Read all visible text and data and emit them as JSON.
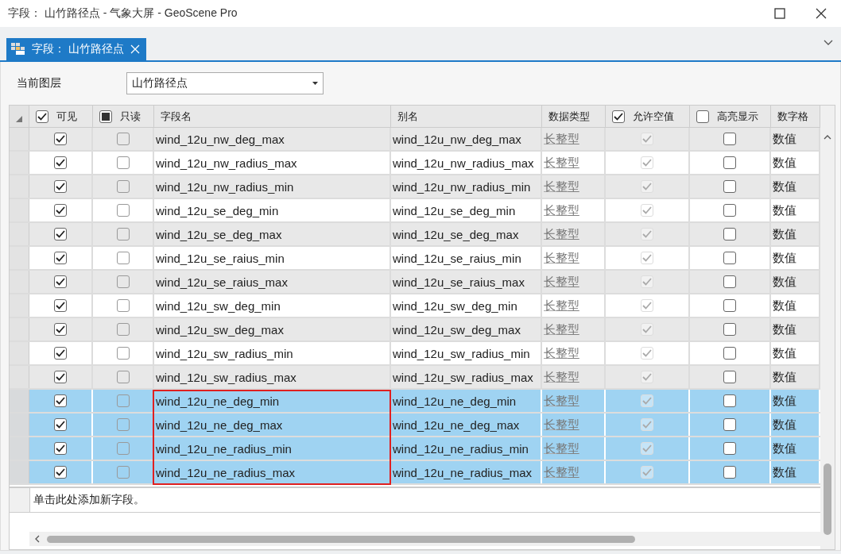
{
  "window": {
    "title": "字段： 山竹路径点 - 气象大屏 - GeoScene Pro"
  },
  "tabs": [
    {
      "label": "字段： 山竹路径点",
      "selected": true
    }
  ],
  "layer": {
    "label": "当前图层",
    "value": "山竹路径点"
  },
  "table": {
    "columns": [
      {
        "label": "可见",
        "kind": "check",
        "checked": true,
        "indeterminate": false
      },
      {
        "label": "只读",
        "kind": "check",
        "checked": false,
        "indeterminate": true
      },
      {
        "label": "字段名",
        "kind": "text"
      },
      {
        "label": "别名",
        "kind": "text"
      },
      {
        "label": "数据类型",
        "kind": "text"
      },
      {
        "label": "允许空值",
        "kind": "check",
        "checked": true,
        "indeterminate": false
      },
      {
        "label": "高亮显示",
        "kind": "check",
        "checked": false,
        "indeterminate": false
      },
      {
        "label": "数字格",
        "kind": "text"
      }
    ],
    "rows": [
      {
        "visible": true,
        "readonly": false,
        "name": "wind_12u_nw_deg_max",
        "alias": "wind_12u_nw_deg_max",
        "type": "长整型",
        "allow_null": true,
        "highlight": false,
        "number_format": "数值",
        "selected": false,
        "outlined": false
      },
      {
        "visible": true,
        "readonly": false,
        "name": "wind_12u_nw_radius_max",
        "alias": "wind_12u_nw_radius_max",
        "type": "长整型",
        "allow_null": true,
        "highlight": false,
        "number_format": "数值",
        "selected": false,
        "outlined": false
      },
      {
        "visible": true,
        "readonly": false,
        "name": "wind_12u_nw_radius_min",
        "alias": "wind_12u_nw_radius_min",
        "type": "长整型",
        "allow_null": true,
        "highlight": false,
        "number_format": "数值",
        "selected": false,
        "outlined": false
      },
      {
        "visible": true,
        "readonly": false,
        "name": "wind_12u_se_deg_min",
        "alias": "wind_12u_se_deg_min",
        "type": "长整型",
        "allow_null": true,
        "highlight": false,
        "number_format": "数值",
        "selected": false,
        "outlined": false
      },
      {
        "visible": true,
        "readonly": false,
        "name": "wind_12u_se_deg_max",
        "alias": "wind_12u_se_deg_max",
        "type": "长整型",
        "allow_null": true,
        "highlight": false,
        "number_format": "数值",
        "selected": false,
        "outlined": false
      },
      {
        "visible": true,
        "readonly": false,
        "name": "wind_12u_se_raius_min",
        "alias": "wind_12u_se_raius_min",
        "type": "长整型",
        "allow_null": true,
        "highlight": false,
        "number_format": "数值",
        "selected": false,
        "outlined": false
      },
      {
        "visible": true,
        "readonly": false,
        "name": "wind_12u_se_raius_max",
        "alias": "wind_12u_se_raius_max",
        "type": "长整型",
        "allow_null": true,
        "highlight": false,
        "number_format": "数值",
        "selected": false,
        "outlined": false
      },
      {
        "visible": true,
        "readonly": false,
        "name": "wind_12u_sw_deg_min",
        "alias": "wind_12u_sw_deg_min",
        "type": "长整型",
        "allow_null": true,
        "highlight": false,
        "number_format": "数值",
        "selected": false,
        "outlined": false
      },
      {
        "visible": true,
        "readonly": false,
        "name": "wind_12u_sw_deg_max",
        "alias": "wind_12u_sw_deg_max",
        "type": "长整型",
        "allow_null": true,
        "highlight": false,
        "number_format": "数值",
        "selected": false,
        "outlined": false
      },
      {
        "visible": true,
        "readonly": false,
        "name": "wind_12u_sw_radius_min",
        "alias": "wind_12u_sw_radius_min",
        "type": "长整型",
        "allow_null": true,
        "highlight": false,
        "number_format": "数值",
        "selected": false,
        "outlined": false
      },
      {
        "visible": true,
        "readonly": false,
        "name": "wind_12u_sw_radius_max",
        "alias": "wind_12u_sw_radius_max",
        "type": "长整型",
        "allow_null": true,
        "highlight": false,
        "number_format": "数值",
        "selected": false,
        "outlined": false
      },
      {
        "visible": true,
        "readonly": false,
        "name": "wind_12u_ne_deg_min",
        "alias": "wind_12u_ne_deg_min",
        "type": "长整型",
        "allow_null": true,
        "highlight": false,
        "number_format": "数值",
        "selected": true,
        "outlined": true
      },
      {
        "visible": true,
        "readonly": false,
        "name": "wind_12u_ne_deg_max",
        "alias": "wind_12u_ne_deg_max",
        "type": "长整型",
        "allow_null": true,
        "highlight": false,
        "number_format": "数值",
        "selected": true,
        "outlined": true
      },
      {
        "visible": true,
        "readonly": false,
        "name": "wind_12u_ne_radius_min",
        "alias": "wind_12u_ne_radius_min",
        "type": "长整型",
        "allow_null": true,
        "highlight": false,
        "number_format": "数值",
        "selected": true,
        "outlined": true
      },
      {
        "visible": true,
        "readonly": false,
        "name": "wind_12u_ne_radius_max",
        "alias": "wind_12u_ne_radius_max",
        "type": "长整型",
        "allow_null": true,
        "highlight": false,
        "number_format": "数值",
        "selected": true,
        "outlined": true
      }
    ],
    "add_row": "单击此处添加新字段。"
  }
}
